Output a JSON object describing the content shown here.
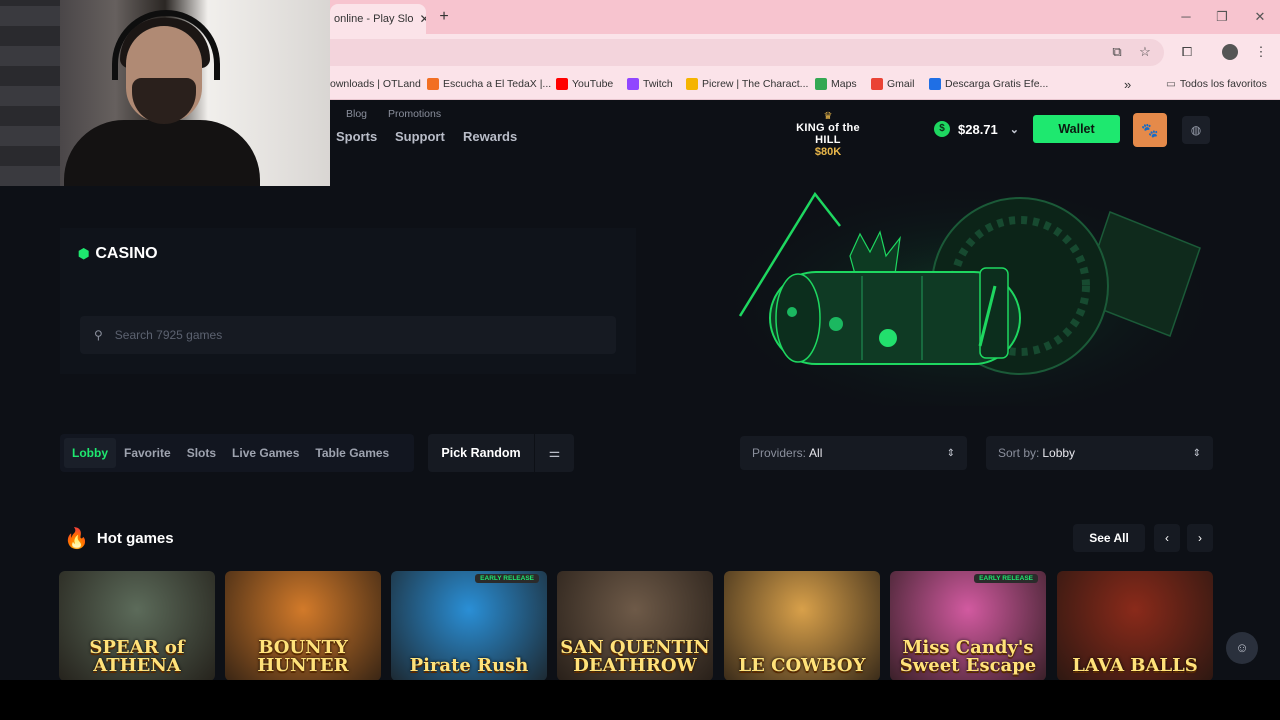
{
  "browser": {
    "tab_title": "online - Play Slo",
    "tab_close": "✕",
    "new_tab": "+",
    "bookmarks": [
      {
        "label": "ownloads | OTLand",
        "icon": "otland-icon",
        "color": "#7a3b2e"
      },
      {
        "label": "Escucha a El TedaX |...",
        "icon": "soundcloud-icon",
        "color": "#f26f23"
      },
      {
        "label": "YouTube",
        "icon": "youtube-icon",
        "color": "#ff0000"
      },
      {
        "label": "Twitch",
        "icon": "twitch-icon",
        "color": "#9146ff"
      },
      {
        "label": "Picrew | The Charact...",
        "icon": "picrew-icon",
        "color": "#f5b400"
      },
      {
        "label": "Maps",
        "icon": "maps-icon",
        "color": "#34a853"
      },
      {
        "label": "Gmail",
        "icon": "gmail-icon",
        "color": "#ea4335"
      },
      {
        "label": "Descarga Gratis Efe...",
        "icon": "freepik-icon",
        "color": "#1f6fe5"
      }
    ],
    "more_bookmarks": "»",
    "all_favorites": "Todos los favoritos"
  },
  "site": {
    "top_links": [
      "Blog",
      "Promotions"
    ],
    "nav": [
      "Sports",
      "Support",
      "Rewards"
    ],
    "promo": {
      "line1": "KING of the HILL",
      "line2": "$80K"
    },
    "balance": "$28.71",
    "wallet_label": "Wallet",
    "casino_title": "CASINO",
    "search_placeholder": "Search 7925 games",
    "tabs": [
      "Lobby",
      "Favorite",
      "Slots",
      "Live Games",
      "Table Games"
    ],
    "active_tab": "Lobby",
    "pick_random": "Pick Random",
    "providers_label": "Providers:",
    "providers_value": "All",
    "sort_label": "Sort by:",
    "sort_value": "Lobby",
    "hot_games_title": "Hot games",
    "see_all": "See All",
    "prev": "‹",
    "next": "›",
    "games": [
      {
        "title": "SPEAR of ATHENA",
        "tag": "",
        "bg": "#5c6b5a"
      },
      {
        "title": "BOUNTY HUNTER",
        "tag": "",
        "bg": "#d27a2a"
      },
      {
        "title": "Pirate Rush",
        "tag": "EARLY RELEASE",
        "bg": "#2a8fd6"
      },
      {
        "title": "SAN QUENTIN DEATHROW",
        "tag": "",
        "bg": "#6e5a48"
      },
      {
        "title": "LE COWBOY",
        "tag": "",
        "bg": "#d8a04a"
      },
      {
        "title": "Miss Candy's Sweet Escape",
        "tag": "EARLY RELEASE",
        "bg": "#d25aa0"
      },
      {
        "title": "LAVA BALLS",
        "tag": "",
        "bg": "#8a2a1a"
      }
    ]
  }
}
